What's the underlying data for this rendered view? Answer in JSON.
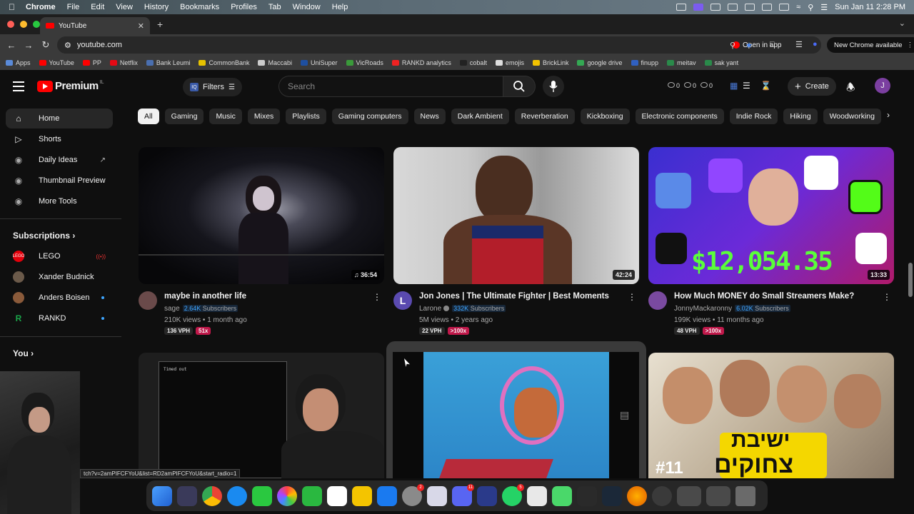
{
  "menubar": {
    "app": "Chrome",
    "items": [
      "File",
      "Edit",
      "View",
      "History",
      "Bookmarks",
      "Profiles",
      "Tab",
      "Window",
      "Help"
    ],
    "clock": "Sun Jan 11  2:28 PM"
  },
  "browser": {
    "tab_title": "YouTube",
    "url": "youtube.com",
    "open_in_app": "Open in app",
    "new_chrome": "New Chrome available",
    "bookmarks": [
      {
        "label": "Apps",
        "color": "#5a8ad8"
      },
      {
        "label": "YouTube",
        "color": "#ff0000"
      },
      {
        "label": "PP",
        "color": "#ff0000"
      },
      {
        "label": "Netflix",
        "color": "#e50914"
      },
      {
        "label": "Bank Leumi",
        "color": "#4a6fb0"
      },
      {
        "label": "CommonBank",
        "color": "#e6c200"
      },
      {
        "label": "Maccabi",
        "color": "#cccccc"
      },
      {
        "label": "UniSuper",
        "color": "#1e4fa0"
      },
      {
        "label": "VicRoads",
        "color": "#3a9a3a"
      },
      {
        "label": "RANKD analytics",
        "color": "#e22"
      },
      {
        "label": "cobalt",
        "color": "#222222"
      },
      {
        "label": "emojis",
        "color": "#dddddd"
      },
      {
        "label": "BrickLink",
        "color": "#f2c200"
      },
      {
        "label": "google drive",
        "color": "#34a853"
      },
      {
        "label": "finupp",
        "color": "#3060c0"
      },
      {
        "label": "meitav",
        "color": "#2a8a4a"
      },
      {
        "label": "sak yant",
        "color": "#2a8a4a"
      }
    ]
  },
  "header": {
    "logo_text": "Premium",
    "logo_country": "IL",
    "filters_label": "Filters",
    "search_placeholder": "Search",
    "stats": [
      "0",
      "0",
      "0"
    ],
    "create_label": "Create",
    "avatar_letter": "J"
  },
  "sidebar": {
    "main": [
      {
        "label": "Home",
        "icon": "home-icon"
      },
      {
        "label": "Shorts",
        "icon": "shorts-icon"
      },
      {
        "label": "Daily Ideas",
        "icon": "ideas-icon"
      },
      {
        "label": "Thumbnail Preview",
        "icon": "thumbnail-icon"
      },
      {
        "label": "More Tools",
        "icon": "tools-icon"
      }
    ],
    "subscriptions_title": "Subscriptions",
    "subscriptions": [
      {
        "label": "LEGO",
        "color": "#e3000b"
      },
      {
        "label": "Xander Budnick",
        "color": "#6b5a4a"
      },
      {
        "label": "Anders Boisen",
        "color": "#8a5a3a"
      },
      {
        "label": "RANKD",
        "color": "#1aa54a"
      }
    ],
    "you_title": "You"
  },
  "chips": [
    "All",
    "Gaming",
    "Music",
    "Mixes",
    "Playlists",
    "Gaming computers",
    "News",
    "Dark Ambient",
    "Reverberation",
    "Kickboxing",
    "Electronic components",
    "Indie Rock",
    "Hiking",
    "Woodworking"
  ],
  "videos": [
    {
      "title": "maybe in another life",
      "channel": "sage",
      "subs": "2.64K",
      "subs_label": "Subscribers",
      "views": "210K views",
      "age": "1 month ago",
      "vph": "136 VPH",
      "ratio": "51x",
      "duration": "36:54",
      "verified": false
    },
    {
      "title": "Jon Jones | The Ultimate Fighter | Best Moments",
      "channel": "Larone",
      "subs": "332K",
      "subs_label": "Subscribers",
      "views": "5M views",
      "age": "2 years ago",
      "vph": "22 VPH",
      "ratio": ">100x",
      "duration": "42:24",
      "verified": true
    },
    {
      "title": "How Much MONEY do Small Streamers Make?",
      "channel": "JonnyMackaronny",
      "subs": "6.02K",
      "subs_label": "Subscribers",
      "views": "199K views",
      "age": "11 months ago",
      "vph": "48 VPH",
      "ratio": ">100x",
      "duration": "13:33",
      "verified": false
    }
  ],
  "thumb_texts": {
    "money": "$12,054.35",
    "terminal_title": "Timed out",
    "hebrew_top": "ישיבת",
    "hebrew_bottom": "צחוקים",
    "episode": "#11"
  },
  "status_link": "tch?v=2amPIFCFYoU&list=RD2amPIFCFYoU&start_radio=1",
  "dock": {
    "badges": [
      "2",
      "11",
      "5"
    ]
  }
}
